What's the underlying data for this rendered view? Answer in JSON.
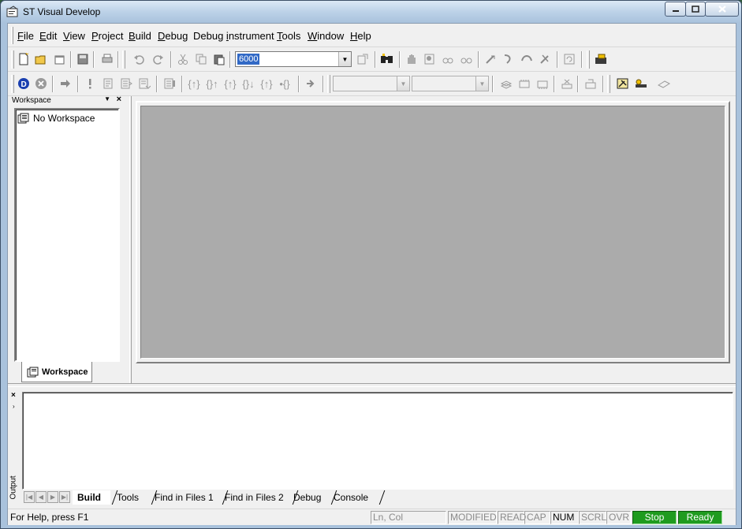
{
  "window": {
    "title": "ST Visual Develop"
  },
  "menubar": {
    "items": [
      "File",
      "Edit",
      "View",
      "Project",
      "Build",
      "Debug",
      "Debug instrument",
      "Tools",
      "Window",
      "Help"
    ],
    "mnemonics": [
      "F",
      "E",
      "V",
      "P",
      "B",
      "D",
      "i",
      "T",
      "W",
      "H"
    ]
  },
  "toolbar": {
    "target_combo_value": "6000",
    "toolbar2_combo1_value": "",
    "toolbar2_combo2_value": ""
  },
  "workspace": {
    "header": "Workspace",
    "tree_root": "No Workspace",
    "tab_label": "Workspace"
  },
  "output": {
    "side_label": "Output",
    "tabs": [
      "Build",
      "Tools",
      "Find in Files 1",
      "Find in Files 2",
      "Debug",
      "Console"
    ],
    "active_tab": "Build"
  },
  "statusbar": {
    "help": "For Help, press F1",
    "position": "Ln, Col",
    "modified": "MODIFIED",
    "read": "READ",
    "cap": "CAP",
    "num": "NUM",
    "scrl": "SCRL",
    "ovr": "OVR",
    "stop": "Stop",
    "ready": "Ready"
  },
  "colors": {
    "mdi_background": "#ababab",
    "status_green": "#1f9b1f",
    "selection": "#3169c6"
  }
}
